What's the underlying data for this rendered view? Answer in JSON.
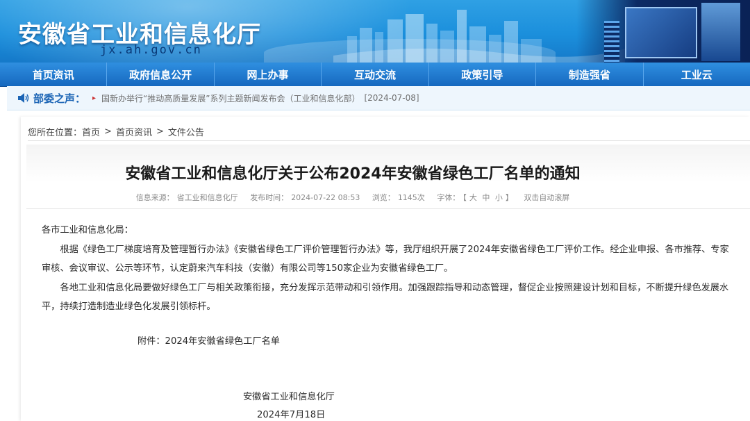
{
  "header": {
    "site_title": "安徽省工业和信息化厅",
    "domain": "jx.ah.gov.cn"
  },
  "nav": {
    "items": [
      "首页资讯",
      "政府信息公开",
      "网上办事",
      "互动交流",
      "政策引导",
      "制造强省",
      "工业云"
    ]
  },
  "ticker": {
    "label": "部委之声：",
    "bullet": "▸",
    "text": "国新办举行“推动高质量发展”系列主题新闻发布会（工业和信息化部）",
    "date": "[2024-07-08]"
  },
  "breadcrumb": {
    "prefix": "您所在位置：",
    "items": [
      "首页",
      "首页资讯",
      "文件公告"
    ],
    "sep": ">"
  },
  "article": {
    "title": "安徽省工业和信息化厅关于公布2024年安徽省绿色工厂名单的通知",
    "meta": {
      "source_label": "信息来源：",
      "source": "省工业和信息化厅",
      "published_label": "发布时间：",
      "published": "2024-07-22 08:53",
      "views_label": "浏览：",
      "views": "1145次",
      "font_label": "字体：",
      "bracket_open": "【",
      "font_large": "大",
      "font_medium": "中",
      "font_small": "小",
      "bracket_close": "】",
      "autoscroll": "双击自动滚屏"
    },
    "salutation": "各市工业和信息化局：",
    "para1": "根据《绿色工厂梯度培育及管理暂行办法》《安徽省绿色工厂评价管理暂行办法》等，我厅组织开展了2024年安徽省绿色工厂评价工作。经企业申报、各市推荐、专家审核、会议审议、公示等环节，认定蔚来汽车科技（安徽）有限公司等150家企业为安徽省绿色工厂。",
    "para2": "各地工业和信息化局要做好绿色工厂与相关政策衔接，充分发挥示范带动和引领作用。加强跟踪指导和动态管理，督促企业按照建设计划和目标，不断提升绿色发展水平，持续打造制造业绿色化发展引领标杆。",
    "attachment": "附件：2024年安徽省绿色工厂名单",
    "signature_org": "安徽省工业和信息化厅",
    "signature_date": "2024年7月18日"
  },
  "colors": {
    "banner_blue": "#1b8fdc",
    "nav_blue": "#1668bf",
    "ticker_label": "#1b64b5"
  },
  "icons": {
    "ticker": "speaker-icon"
  }
}
